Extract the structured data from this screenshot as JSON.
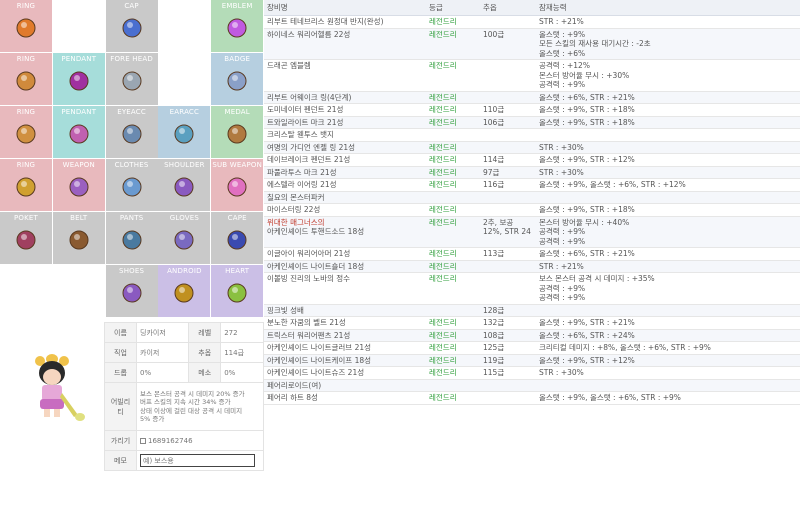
{
  "slots": [
    {
      "label": "RING",
      "color": "pink",
      "icon": "ring-icon"
    },
    {
      "label": "CAP",
      "color": "gray",
      "icon": "cap-icon"
    },
    {
      "label": "EMBLEM",
      "color": "green",
      "icon": "emblem-icon"
    },
    {
      "label": "RING",
      "color": "pink",
      "icon": "ring-icon"
    },
    {
      "label": "PENDANT",
      "color": "teal",
      "icon": "pendant-icon"
    },
    {
      "label": "FORE HEAD",
      "color": "gray",
      "icon": "forehead-icon"
    },
    {
      "label": "BADGE",
      "color": "blue",
      "icon": "badge-icon"
    },
    {
      "label": "RING",
      "color": "pink",
      "icon": "ring-icon"
    },
    {
      "label": "PENDANT",
      "color": "teal",
      "icon": "pendant-icon"
    },
    {
      "label": "EYEACC",
      "color": "gray",
      "icon": "eyeacc-icon"
    },
    {
      "label": "EARACC",
      "color": "blue",
      "icon": "earacc-icon"
    },
    {
      "label": "MEDAL",
      "color": "green",
      "icon": "medal-icon"
    },
    {
      "label": "RING",
      "color": "pink",
      "icon": "ring-icon"
    },
    {
      "label": "WEAPON",
      "color": "pink",
      "icon": "weapon-icon"
    },
    {
      "label": "CLOTHES",
      "color": "gray",
      "icon": "clothes-icon"
    },
    {
      "label": "SHOULDER",
      "color": "gray",
      "icon": "shoulder-icon"
    },
    {
      "label": "SUB WEAPON",
      "color": "pink",
      "icon": "subweapon-icon"
    },
    {
      "label": "POKET",
      "color": "gray",
      "icon": "pocket-icon"
    },
    {
      "label": "BELT",
      "color": "gray",
      "icon": "belt-icon"
    },
    {
      "label": "PANTS",
      "color": "gray",
      "icon": "pants-icon"
    },
    {
      "label": "GLOVES",
      "color": "gray",
      "icon": "gloves-icon"
    },
    {
      "label": "CAPE",
      "color": "gray",
      "icon": "cape-icon"
    },
    {
      "label": "SHOES",
      "color": "gray",
      "icon": "shoes-icon"
    },
    {
      "label": "ANDROID",
      "color": "purple",
      "icon": "android-icon"
    },
    {
      "label": "HEART",
      "color": "purple",
      "icon": "heart-icon"
    }
  ],
  "character": {
    "name_label": "이름",
    "name": "딩카이저",
    "level_label": "레벨",
    "level": "272",
    "job_label": "직업",
    "job": "카이저",
    "arcane_label": "추옵",
    "arcane": "114급",
    "drop_label": "드롭",
    "drop": "0%",
    "meso_label": "메소",
    "meso": "0%",
    "ability_label": "어빌리티",
    "ability_lines": [
      "보스 몬스터 공격 시 데미지 20% 증가",
      "버프 스킬의 지속 시간 34% 증가",
      "상태 이상에 걸린 대상 공격 시 데미지",
      "5% 증가"
    ],
    "hide_label": "가리기",
    "hide_value": "1689162746",
    "memo_label": "메모",
    "memo_placeholder": "예) 보스용"
  },
  "equip_headers": {
    "name": "장비명",
    "grade": "등급",
    "star": "추옵",
    "potential": "잠재능력"
  },
  "equipment": [
    {
      "name": "리부트 테네브리스 원정대 반지(완성)",
      "grade": "레전드리",
      "star": "",
      "potential": [
        "STR : +21%"
      ]
    },
    {
      "name": "하이네스 워리어헬름 22성",
      "grade": "레전드리",
      "star": "100급",
      "potential": [
        "올스탯 : +9%",
        "모든 스킬의 재사용 대기시간 : -2초",
        "올스탯 : +6%"
      ]
    },
    {
      "name": "드래곤 엠블렘",
      "grade": "레전드리",
      "star": "",
      "potential": [
        "공격력 : +12%",
        "몬스터 방어율 무시 : +30%",
        "공격력 : +9%"
      ]
    },
    {
      "name": "리부트 어웨이크 링(4단계)",
      "grade": "레전드리",
      "star": "",
      "potential": [
        "올스탯 : +6%, STR : +21%"
      ]
    },
    {
      "name": "도미네이터 펜던트 21성",
      "grade": "레전드리",
      "star": "110급",
      "potential": [
        "올스탯 : +9%, STR : +18%"
      ]
    },
    {
      "name": "트와일라이트 마크 21성",
      "grade": "레전드리",
      "star": "106급",
      "potential": [
        "올스탯 : +9%, STR : +18%"
      ]
    },
    {
      "name": "크리스탈 웬투스 뱃지",
      "grade": "",
      "star": "",
      "potential": []
    },
    {
      "name": "여명의 가디언 엔젤 링 21성",
      "grade": "레전드리",
      "star": "",
      "potential": [
        "STR : +30%"
      ]
    },
    {
      "name": "데이브레이크 펜던트 21성",
      "grade": "레전드리",
      "star": "114급",
      "potential": [
        "올스탯 : +9%, STR : +12%"
      ]
    },
    {
      "name": "파풀라투스 마크 21성",
      "grade": "레전드리",
      "star": "97급",
      "potential": [
        "STR : +30%"
      ]
    },
    {
      "name": "에스텔라 이어링 21성",
      "grade": "레전드리",
      "star": "116급",
      "potential": [
        "올스탯 : +9%, 올스탯 : +6%, STR : +12%"
      ]
    },
    {
      "name": "칠요의 몬스터파커",
      "grade": "",
      "star": "",
      "potential": []
    },
    {
      "name": "마이스터링 22성",
      "grade": "레전드리",
      "star": "",
      "potential": [
        "올스탯 : +9%, STR : +18%"
      ]
    },
    {
      "name": "위대한 매그너스의",
      "name2": "아케인셰이드 투핸드소드 18성",
      "grade": "레전드리",
      "star": "2추, 보공 12%, STR 24",
      "potential": [
        "몬스터 방어율 무시 : +40%",
        "공격력 : +9%",
        "공격력 : +9%"
      ],
      "red": true
    },
    {
      "name": "이글아이 워리어아머 21성",
      "grade": "레전드리",
      "star": "113급",
      "potential": [
        "올스탯 : +6%, STR : +21%"
      ]
    },
    {
      "name": "아케인셰이드 나이트숄더 18성",
      "grade": "레전드리",
      "star": "",
      "potential": [
        "STR : +21%"
      ]
    },
    {
      "name": "이볼빙 진리의 노바의 정수",
      "grade": "레전드리",
      "star": "",
      "potential": [
        "보스 몬스터 공격 시 데미지 : +35%",
        "공격력 : +9%",
        "공격력 : +9%"
      ]
    },
    {
      "name": "핑크빛 성배",
      "grade": "",
      "star": "128급",
      "potential": []
    },
    {
      "name": "분노한 자쿰의 벨트 21성",
      "grade": "레전드리",
      "star": "132급",
      "potential": [
        "올스탯 : +9%, STR : +21%"
      ]
    },
    {
      "name": "트릭스터 워리어팬츠 21성",
      "grade": "레전드리",
      "star": "108급",
      "potential": [
        "올스탯 : +6%, STR : +24%"
      ]
    },
    {
      "name": "아케인셰이드 나이트글러브 21성",
      "grade": "레전드리",
      "star": "125급",
      "potential": [
        "크리티컬 데미지 : +8%, 올스탯 : +6%, STR : +9%"
      ]
    },
    {
      "name": "아케인셰이드 나이트케이프 18성",
      "grade": "레전드리",
      "star": "119급",
      "potential": [
        "올스탯 : +9%, STR : +12%"
      ]
    },
    {
      "name": "아케인셰이드 나이트슈즈 21성",
      "grade": "레전드리",
      "star": "115급",
      "potential": [
        "STR : +30%"
      ]
    },
    {
      "name": "페어리로이드(여)",
      "grade": "",
      "star": "",
      "potential": []
    },
    {
      "name": "페어리 하트 8성",
      "grade": "레전드리",
      "star": "",
      "potential": [
        "올스탯 : +9%, 올스탯 : +6%, STR : +9%"
      ]
    }
  ]
}
